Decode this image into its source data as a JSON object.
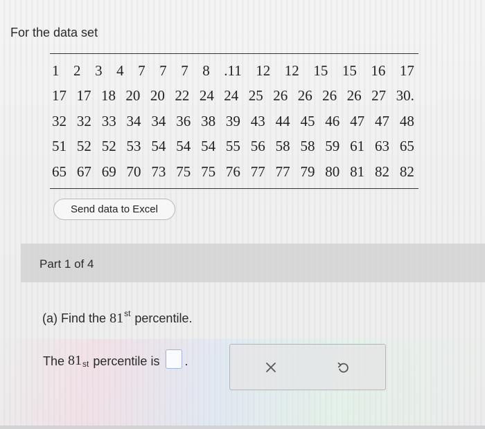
{
  "header": {
    "title": "For the data set"
  },
  "data_set": {
    "rows": [
      [
        "1",
        "2",
        "3",
        "4",
        "7",
        "7",
        "7",
        "8",
        ".11",
        "12",
        "12",
        "15",
        "15",
        "16",
        "17"
      ],
      [
        "17",
        "17",
        "18",
        "20",
        "20",
        "22",
        "24",
        "24",
        "25",
        "26",
        "26",
        "26",
        "26",
        "27",
        "30."
      ],
      [
        "32",
        "32",
        "33",
        "34",
        "34",
        "36",
        "38",
        "39",
        "43",
        "44",
        "45",
        "46",
        "47",
        "47",
        "48"
      ],
      [
        "51",
        "52",
        "52",
        "53",
        "54",
        "54",
        "54",
        "55",
        "56",
        "58",
        "58",
        "59",
        "61",
        "63",
        "65"
      ],
      [
        "65",
        "67",
        "69",
        "70",
        "73",
        "75",
        "75",
        "76",
        "77",
        "77",
        "79",
        "80",
        "81",
        "82",
        "82"
      ]
    ]
  },
  "excel_button": {
    "label": "Send data to Excel"
  },
  "part": {
    "label": "Part 1 of 4"
  },
  "question": {
    "prefix": "(a) Find the",
    "number": "81",
    "superscript": "st",
    "suffix": "percentile."
  },
  "answer": {
    "prefix": "The",
    "number": "81",
    "superscript": "st",
    "suffix": "percentile is",
    "period": "."
  },
  "icons": {
    "clear": "close-icon",
    "undo": "undo-icon"
  },
  "colors": {
    "answer_box_border": "#9fb6d9",
    "part_bar_bg": "#d2d2d4"
  }
}
